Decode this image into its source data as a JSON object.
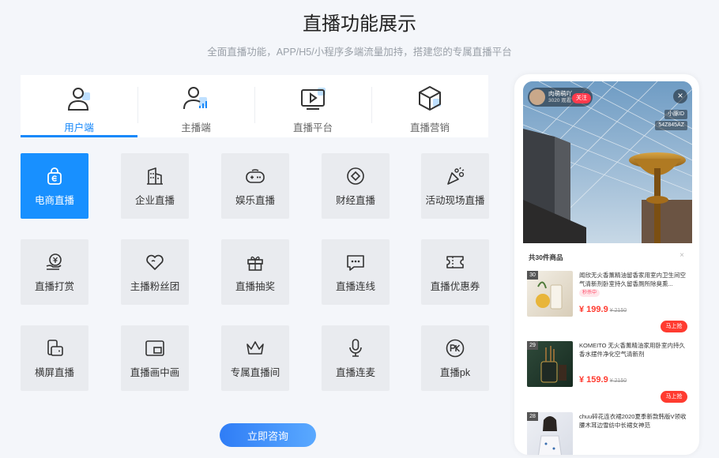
{
  "header": {
    "title": "直播功能展示",
    "subtitle": "全面直播功能，APP/H5/小程序多端流量加持，搭建您的专属直播平台"
  },
  "tabs": [
    {
      "label": "用户端",
      "icon": "user-icon",
      "active": true
    },
    {
      "label": "主播端",
      "icon": "anchor-icon",
      "active": false
    },
    {
      "label": "直播平台",
      "icon": "play-screen-icon",
      "active": false
    },
    {
      "label": "直播营销",
      "icon": "cube-icon",
      "active": false
    }
  ],
  "features": [
    {
      "label": "电商直播",
      "icon": "shopping-bag-icon",
      "active": true
    },
    {
      "label": "企业直播",
      "icon": "building-icon"
    },
    {
      "label": "娱乐直播",
      "icon": "gamepad-icon"
    },
    {
      "label": "财经直播",
      "icon": "diamond-icon"
    },
    {
      "label": "活动现场直播",
      "icon": "party-icon"
    },
    {
      "label": "直播打赏",
      "icon": "yuan-hand-icon"
    },
    {
      "label": "主播粉丝团",
      "icon": "heart-icon"
    },
    {
      "label": "直播抽奖",
      "icon": "gift-icon"
    },
    {
      "label": "直播连线",
      "icon": "chat-icon"
    },
    {
      "label": "直播优惠券",
      "icon": "ticket-icon"
    },
    {
      "label": "横屏直播",
      "icon": "rotate-screen-icon"
    },
    {
      "label": "直播画中画",
      "icon": "picture-in-picture-icon"
    },
    {
      "label": "专属直播间",
      "icon": "crown-icon"
    },
    {
      "label": "直播连麦",
      "icon": "microphone-icon"
    },
    {
      "label": "直播pk",
      "icon": "pk-icon"
    }
  ],
  "cta": {
    "label": "立即咨询"
  },
  "phone": {
    "host_name": "肉萌萌吖",
    "viewers": "3020 观看",
    "follow_label": "关注",
    "room_label": "小豚ID",
    "room_id": "54Z845AZ",
    "sheet_title": "共30件商品",
    "close_glyph": "×",
    "products": [
      {
        "index": "30",
        "name": "闻欣无火香薰精油留香家用室内卫生间空气清新剂卧室持久留香厕所除臭熏...",
        "badge": "秒杀中",
        "price": "¥ 199.9",
        "old_price": "¥ 2150",
        "buy": "马上抢"
      },
      {
        "index": "29",
        "name": "KOMEITO 无火香薰精油家用卧室内持久香水摆件净化空气清新剂",
        "badge": "",
        "price": "¥ 159.9",
        "old_price": "¥ 2150",
        "buy": "马上抢"
      },
      {
        "index": "28",
        "name": "chuu碎花连衣裙2020夏季新款韩版V领收腰木耳边雪纺中长裙女神范",
        "badge": "",
        "price": "",
        "old_price": "",
        "buy": ""
      }
    ]
  }
}
